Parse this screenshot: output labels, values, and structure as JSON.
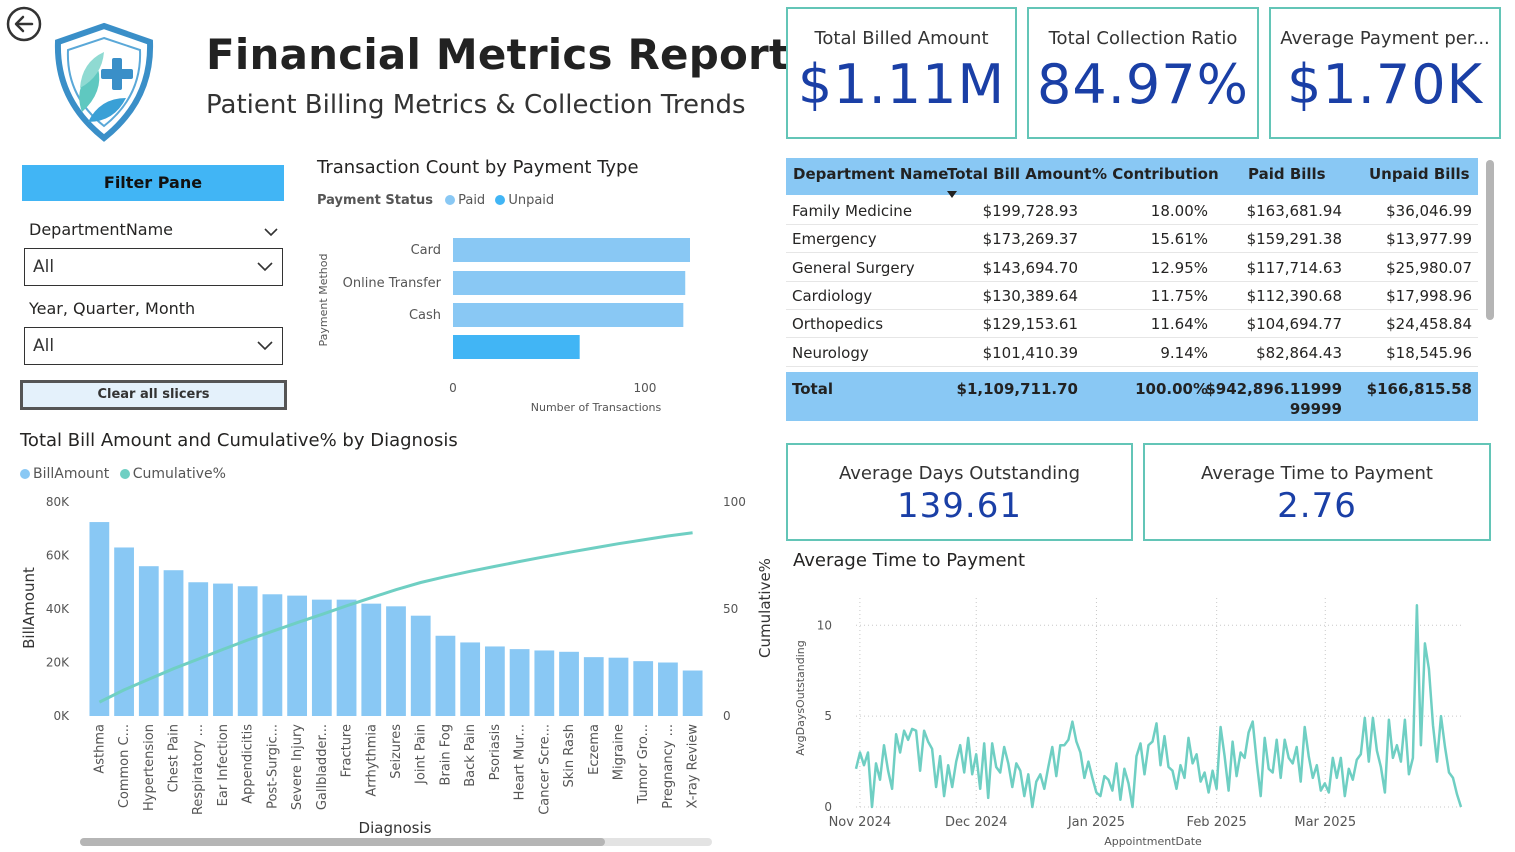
{
  "header": {
    "title": "Financial Metrics Reports",
    "subtitle": "Patient Billing Metrics & Collection Trends"
  },
  "kpis": [
    {
      "label": "Total Billed Amount",
      "value": "$1.11M"
    },
    {
      "label": "Total Collection Ratio",
      "value": "84.97%"
    },
    {
      "label": "Average Payment per...",
      "value": "$1.70K"
    }
  ],
  "kpis2": [
    {
      "label": "Average Days Outstanding",
      "value": "139.61"
    },
    {
      "label": "Average Time to Payment",
      "value": "2.76"
    }
  ],
  "filter": {
    "title": "Filter Pane",
    "department_label": "DepartmentName",
    "department_value": "All",
    "date_label": "Year, Quarter, Month",
    "date_value": "All",
    "clear_label": "Clear all slicers"
  },
  "colors": {
    "accent_teal": "#63c5b7",
    "kpi_value": "#1a3fa6",
    "bar_light": "#89c8f4",
    "bar_dark": "#41b5f5",
    "line_teal": "#6fcfc3"
  },
  "table": {
    "headers": [
      "Department Name",
      "Total Bill Amount",
      "% Contribution",
      "Paid Bills",
      "Unpaid Bills"
    ],
    "rows": [
      [
        "Family Medicine",
        "$199,728.93",
        "18.00%",
        "$163,681.94",
        "$36,046.99"
      ],
      [
        "Emergency",
        "$173,269.37",
        "15.61%",
        "$159,291.38",
        "$13,977.99"
      ],
      [
        "General Surgery",
        "$143,694.70",
        "12.95%",
        "$117,714.63",
        "$25,980.07"
      ],
      [
        "Cardiology",
        "$130,389.64",
        "11.75%",
        "$112,390.68",
        "$17,998.96"
      ],
      [
        "Orthopedics",
        "$129,153.61",
        "11.64%",
        "$104,694.77",
        "$24,458.84"
      ],
      [
        "Neurology",
        "$101,410.39",
        "9.14%",
        "$82,864.43",
        "$18,545.96"
      ]
    ],
    "total": {
      "label": "Total",
      "bill": "$1,109,711.70",
      "pct": "100.00%",
      "paid_line1": "$942,896.11999",
      "paid_line2": "99999",
      "unpaid": "$166,815.58"
    }
  },
  "chart_data": [
    {
      "type": "bar",
      "orientation": "horizontal",
      "title": "Transaction Count by Payment Type",
      "legend_title": "Payment Status",
      "legend": [
        "Paid",
        "Unpaid"
      ],
      "ylabel": "Payment Method",
      "xlabel": "Number of Transactions",
      "categories": [
        "Card",
        "Online Transfer",
        "Cash",
        ""
      ],
      "values": [
        124,
        121,
        120,
        66
      ],
      "status": [
        "Paid",
        "Paid",
        "Paid",
        "Unpaid"
      ],
      "xlim": [
        0,
        124
      ],
      "xticks": [
        0,
        100
      ]
    },
    {
      "type": "bar",
      "title": "Total Bill Amount and Cumulative% by Diagnosis",
      "legend": [
        "BillAmount",
        "Cumulative%"
      ],
      "xlabel": "Diagnosis",
      "ylabel": "BillAmount",
      "y2label": "Cumulative%",
      "ylim": [
        0,
        80000
      ],
      "yticks": [
        "0K",
        "20K",
        "40K",
        "60K",
        "80K"
      ],
      "y2lim": [
        0,
        100
      ],
      "y2ticks": [
        0,
        50,
        100
      ],
      "categories": [
        "Asthma",
        "Common C...",
        "Hypertension",
        "Chest Pain",
        "Respiratory ...",
        "Ear Infection",
        "Appendicitis",
        "Post-Surgic...",
        "Severe Injury",
        "Gallbladder...",
        "Fracture",
        "Arrhythmia",
        "Seizures",
        "Joint Pain",
        "Brain Fog",
        "Back Pain",
        "Psoriasis",
        "Heart Mur...",
        "Cancer Scre...",
        "Skin Rash",
        "Eczema",
        "Migraine",
        "Tumor Gro...",
        "Pregnancy ...",
        "X-ray Review"
      ],
      "values": [
        72500,
        63000,
        56000,
        54500,
        50000,
        49500,
        48500,
        45500,
        45000,
        43500,
        43500,
        42000,
        41000,
        37500,
        30000,
        27500,
        26000,
        25000,
        24500,
        24000,
        22000,
        21800,
        20500,
        20000,
        17000
      ],
      "cumulative": [
        6.5,
        12.2,
        17.2,
        22.1,
        26.6,
        31.1,
        35.5,
        39.6,
        43.6,
        47.5,
        51.5,
        55.3,
        59.0,
        62.4,
        65.1,
        67.6,
        69.9,
        72.2,
        74.4,
        76.5,
        78.5,
        80.5,
        82.3,
        84.1,
        85.6
      ]
    },
    {
      "type": "line",
      "title": "Average Time to Payment",
      "xlabel": "AppointmentDate",
      "ylabel": "AvgDaysOutstanding",
      "xticks": [
        "Nov 2024",
        "Dec 2024",
        "Jan 2025",
        "Feb 2025",
        "Mar 2025"
      ],
      "x_range": [
        "2024-10-31",
        "2025-04-05"
      ],
      "ylim": [
        0,
        11.5
      ],
      "yticks": [
        0,
        5,
        10
      ],
      "values": [
        2.1,
        3.0,
        2.3,
        3.0,
        0.0,
        2.4,
        1.5,
        3.4,
        2.0,
        1.0,
        4.0,
        3.0,
        4.2,
        3.7,
        4.3,
        4.2,
        2.0,
        4.2,
        3.6,
        3.2,
        1.1,
        2.8,
        0.6,
        2.3,
        1.1,
        2.5,
        3.4,
        1.9,
        3.8,
        1.8,
        2.9,
        1.0,
        3.5,
        0.5,
        3.5,
        2.2,
        1.9,
        3.3,
        2.4,
        1.1,
        2.4,
        2.0,
        0.6,
        1.8,
        0.0,
        1.4,
        1.8,
        1.0,
        2.2,
        3.3,
        1.7,
        3.4,
        3.4,
        3.7,
        4.7,
        3.6,
        3.0,
        1.6,
        2.5,
        1.6,
        0.8,
        0.6,
        1.7,
        1.5,
        0.9,
        2.4,
        0.4,
        2.1,
        1.3,
        0.0,
        2.8,
        3.5,
        1.8,
        3.4,
        3.6,
        4.6,
        2.3,
        3.9,
        2.2,
        2.0,
        1.0,
        2.3,
        1.6,
        3.8,
        2.4,
        2.9,
        1.4,
        1.9,
        0.8,
        2.0,
        1.0,
        4.4,
        2.8,
        0.9,
        3.6,
        1.7,
        3.0,
        2.7,
        4.1,
        4.7,
        2.5,
        0.6,
        3.8,
        2.1,
        1.9,
        3.7,
        1.6,
        3.7,
        2.7,
        2.4,
        3.3,
        1.4,
        4.4,
        2.8,
        1.6,
        2.3,
        0.9,
        1.3,
        0.8,
        2.7,
        1.6,
        2.7,
        0.6,
        2.1,
        1.5,
        2.6,
        2.9,
        4.9,
        2.5,
        4.9,
        3.1,
        2.2,
        0.8,
        4.8,
        2.7,
        3.4,
        2.5,
        4.8,
        1.8,
        2.7,
        11.1,
        3.4,
        9.0,
        7.6,
        4.5,
        2.5,
        5.0,
        3.3,
        1.9,
        1.6,
        0.7,
        0.0
      ]
    }
  ]
}
